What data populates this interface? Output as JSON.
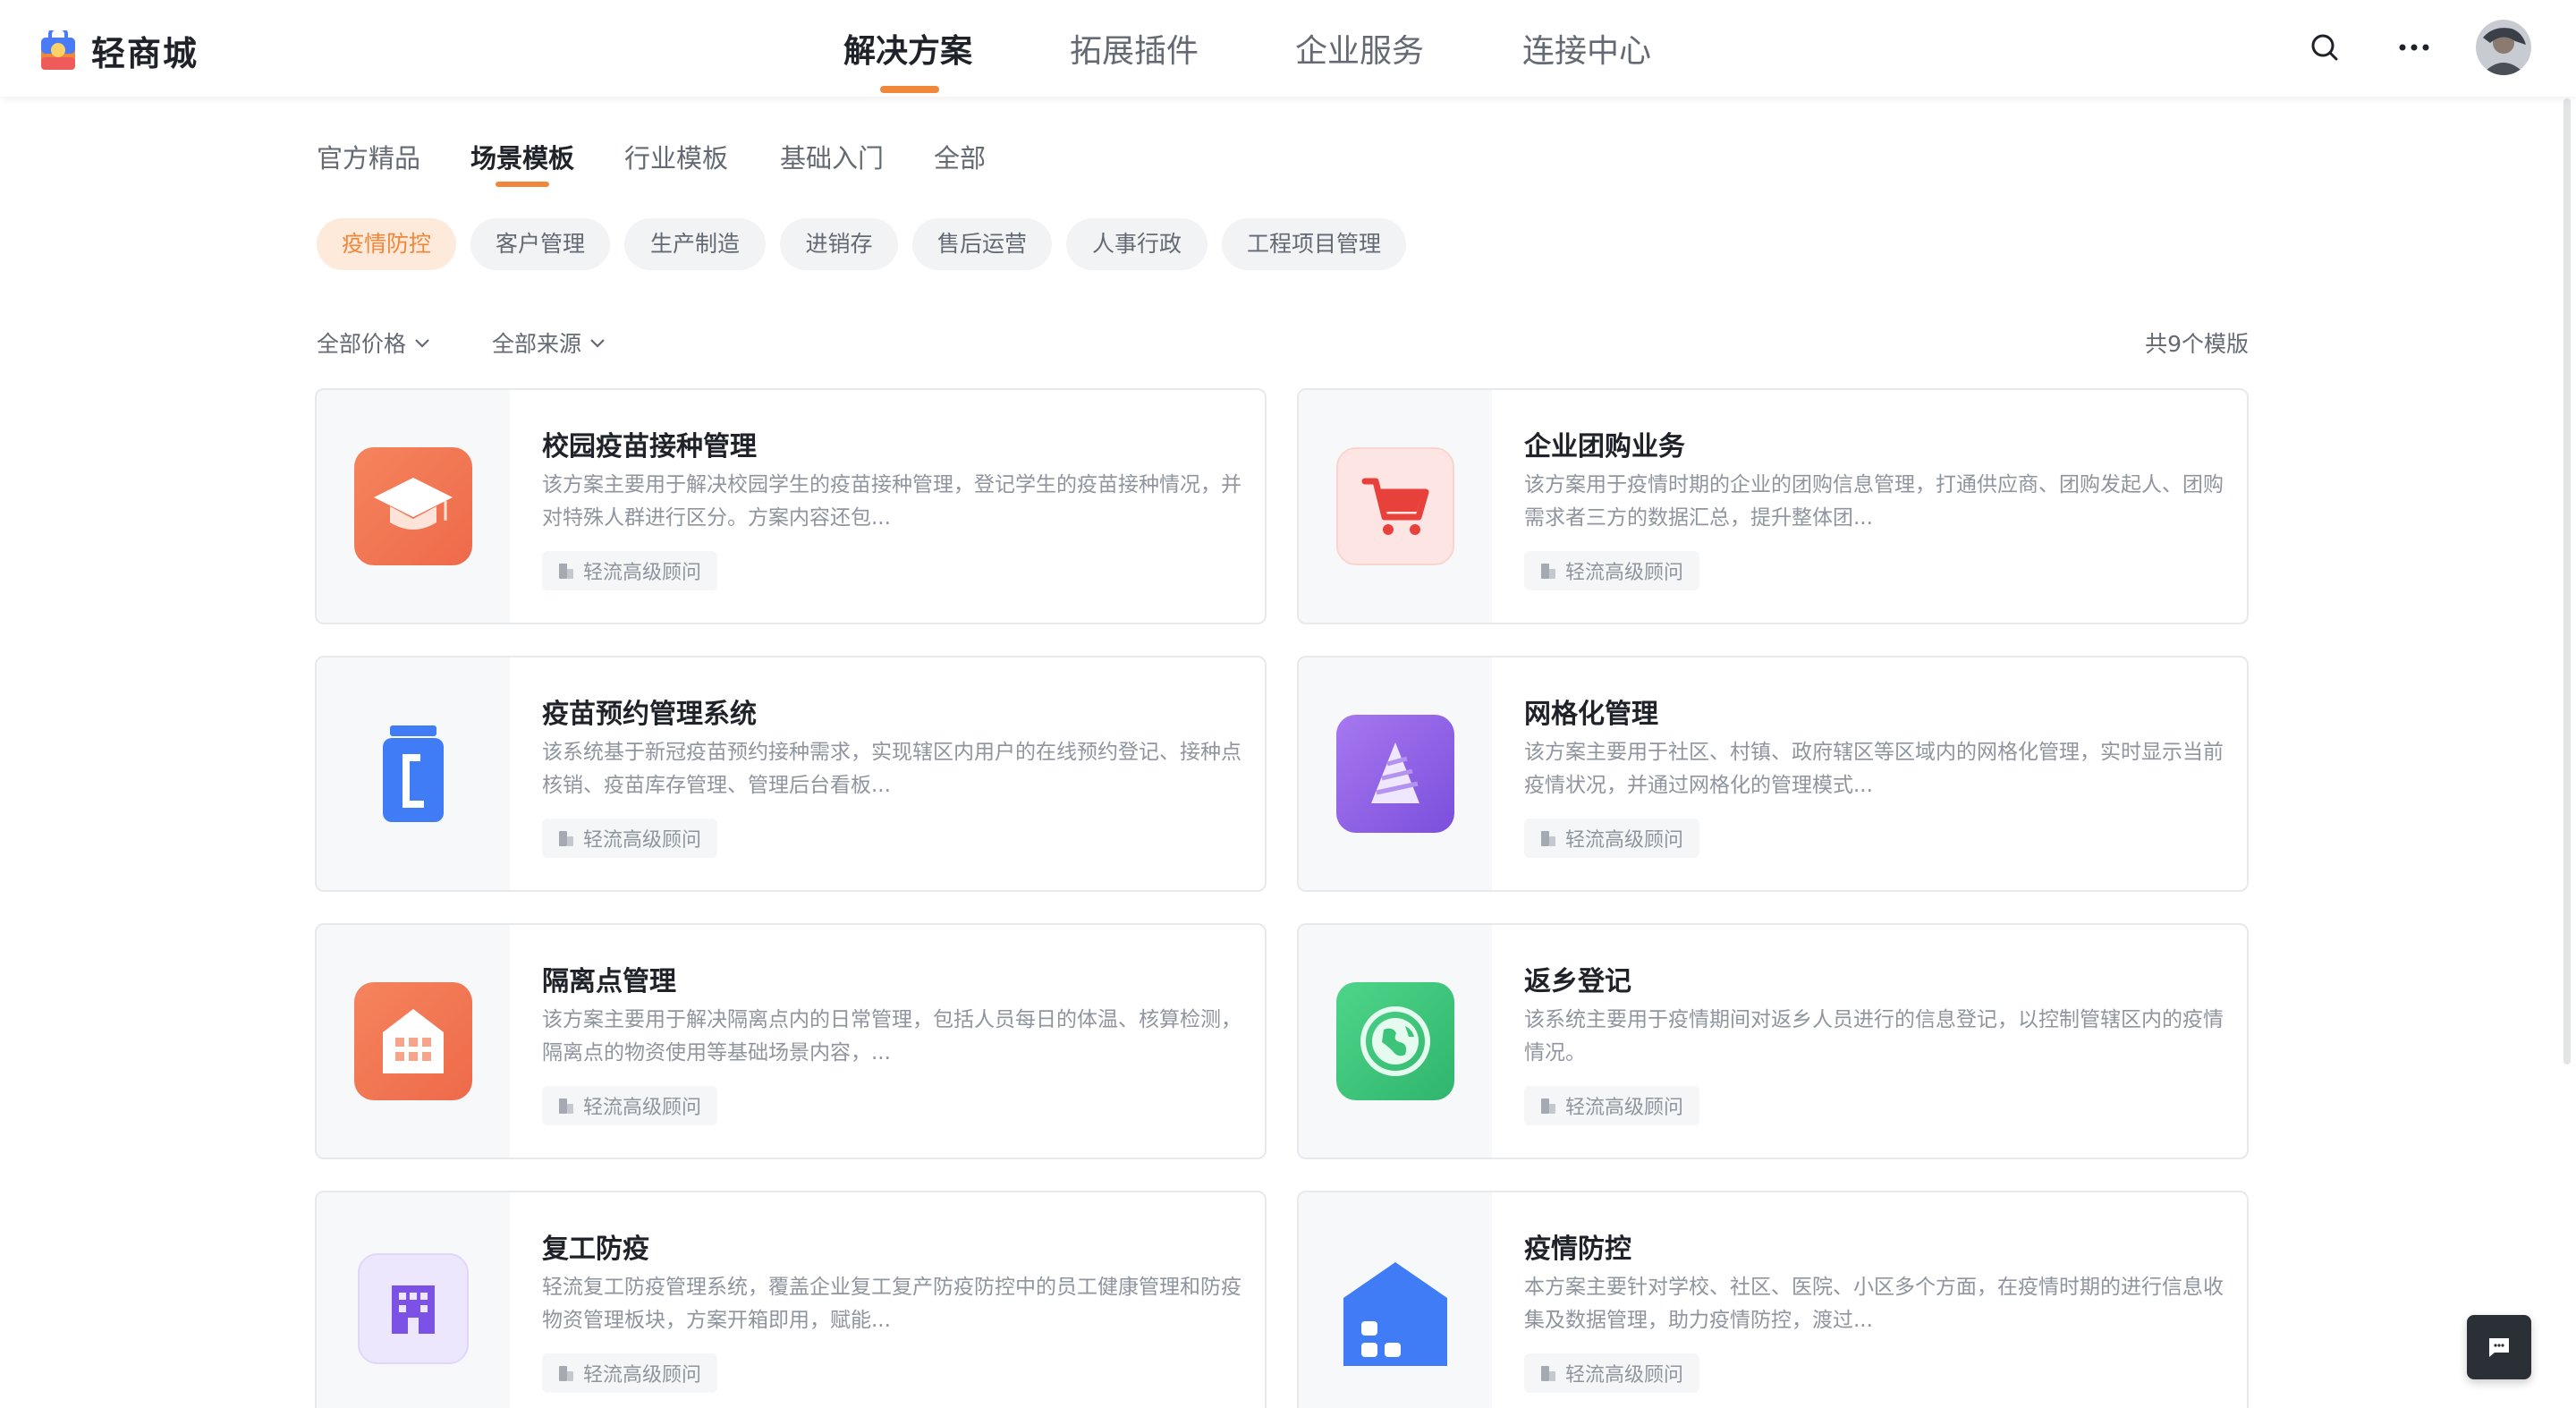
{
  "app": {
    "name": "轻商城"
  },
  "nav": {
    "items": [
      "解决方案",
      "拓展插件",
      "企业服务",
      "连接中心"
    ],
    "active_index": 0
  },
  "header_icons": [
    "search-icon",
    "more-icon",
    "avatar"
  ],
  "subtabs": {
    "items": [
      "官方精品",
      "场景模板",
      "行业模板",
      "基础入门",
      "全部"
    ],
    "active_index": 1
  },
  "chips": {
    "items": [
      "疫情防控",
      "客户管理",
      "生产制造",
      "进销存",
      "售后运营",
      "人事行政",
      "工程项目管理"
    ],
    "active_index": 0
  },
  "filters": {
    "price": "全部价格",
    "source": "全部来源",
    "count": "共9个模版"
  },
  "colors": {
    "accent": "#f0873a",
    "chip_active_bg": "#fdeadb"
  },
  "cards": [
    {
      "title": "校园疫苗接种管理",
      "desc": "该方案主要用于解决校园学生的疫苗接种管理，登记学生的疫苗接种情况，并对特殊人群进行区分。方案内容还包...",
      "tag": "轻流高级顾问",
      "icon": "graduation-cap-icon"
    },
    {
      "title": "企业团购业务",
      "desc": "该方案用于疫情时期的企业的团购信息管理，打通供应商、团购发起人、团购需求者三方的数据汇总，提升整体团...",
      "tag": "轻流高级顾问",
      "icon": "shopping-cart-icon"
    },
    {
      "title": "疫苗预约管理系统",
      "desc": "该系统基于新冠疫苗预约接种需求，实现辖区内用户的在线预约登记、接种点核销、疫苗库存管理、管理后台看板...",
      "tag": "轻流高级顾问",
      "icon": "vaccine-bottle-icon"
    },
    {
      "title": "网格化管理",
      "desc": "该方案主要用于社区、村镇、政府辖区等区域内的网格化管理，实时显示当前疫情状况，并通过网格化的管理模式...",
      "tag": "轻流高级顾问",
      "icon": "grid-cone-icon"
    },
    {
      "title": "隔离点管理",
      "desc": "该方案主要用于解决隔离点内的日常管理，包括人员每日的体温、核算检测，隔离点的物资使用等基础场景内容，...",
      "tag": "轻流高级顾问",
      "icon": "building-icon"
    },
    {
      "title": "返乡登记",
      "desc": "该系统主要用于疫情期间对返乡人员进行的信息登记，以控制管辖区内的疫情情况。",
      "tag": "轻流高级顾问",
      "icon": "globe-icon"
    },
    {
      "title": "复工防疫",
      "desc": "轻流复工防疫管理系统，覆盖企业复工复产防疫防控中的员工健康管理和防疫物资管理板块，方案开箱即用，赋能...",
      "tag": "轻流高级顾问",
      "icon": "office-building-icon"
    },
    {
      "title": "疫情防控",
      "desc": "本方案主要针对学校、社区、医院、小区多个方面，在疫情时期的进行信息收集及数据管理，助力疫情防控，渡过...",
      "tag": "轻流高级顾问",
      "icon": "house-icon"
    }
  ]
}
